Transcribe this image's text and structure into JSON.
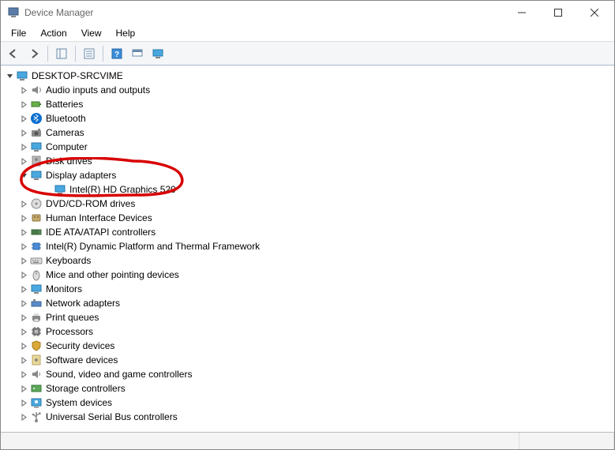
{
  "window": {
    "title": "Device Manager"
  },
  "menu": {
    "file": "File",
    "action": "Action",
    "view": "View",
    "help": "Help"
  },
  "tree": {
    "root": {
      "label": "DESKTOP-SRCVIME",
      "expanded": true,
      "icon": "computer"
    },
    "nodes": [
      {
        "label": "Audio inputs and outputs",
        "icon": "audio",
        "expanded": false,
        "children": []
      },
      {
        "label": "Batteries",
        "icon": "battery",
        "expanded": false,
        "children": []
      },
      {
        "label": "Bluetooth",
        "icon": "bluetooth",
        "expanded": false,
        "children": []
      },
      {
        "label": "Cameras",
        "icon": "camera",
        "expanded": false,
        "children": []
      },
      {
        "label": "Computer",
        "icon": "monitor",
        "expanded": false,
        "children": []
      },
      {
        "label": "Disk drives",
        "icon": "disk",
        "expanded": false,
        "children": []
      },
      {
        "label": "Display adapters",
        "icon": "monitor",
        "expanded": true,
        "children": [
          {
            "label": "Intel(R) HD Graphics 520",
            "icon": "monitor"
          }
        ]
      },
      {
        "label": "DVD/CD-ROM drives",
        "icon": "optical",
        "expanded": false,
        "children": []
      },
      {
        "label": "Human Interface Devices",
        "icon": "hid",
        "expanded": false,
        "children": []
      },
      {
        "label": "IDE ATA/ATAPI controllers",
        "icon": "ide",
        "expanded": false,
        "children": []
      },
      {
        "label": "Intel(R) Dynamic Platform and Thermal Framework",
        "icon": "chip",
        "expanded": false,
        "children": []
      },
      {
        "label": "Keyboards",
        "icon": "keyboard",
        "expanded": false,
        "children": []
      },
      {
        "label": "Mice and other pointing devices",
        "icon": "mouse",
        "expanded": false,
        "children": []
      },
      {
        "label": "Monitors",
        "icon": "monitor",
        "expanded": false,
        "children": []
      },
      {
        "label": "Network adapters",
        "icon": "network",
        "expanded": false,
        "children": []
      },
      {
        "label": "Print queues",
        "icon": "printer",
        "expanded": false,
        "children": []
      },
      {
        "label": "Processors",
        "icon": "cpu",
        "expanded": false,
        "children": []
      },
      {
        "label": "Security devices",
        "icon": "security",
        "expanded": false,
        "children": []
      },
      {
        "label": "Software devices",
        "icon": "software",
        "expanded": false,
        "children": []
      },
      {
        "label": "Sound, video and game controllers",
        "icon": "sound",
        "expanded": false,
        "children": []
      },
      {
        "label": "Storage controllers",
        "icon": "storage",
        "expanded": false,
        "children": []
      },
      {
        "label": "System devices",
        "icon": "system",
        "expanded": false,
        "children": []
      },
      {
        "label": "Universal Serial Bus controllers",
        "icon": "usb",
        "expanded": false,
        "children": []
      }
    ]
  },
  "annotation": {
    "highlighted_category": "Display adapters",
    "color": "#d80000"
  }
}
